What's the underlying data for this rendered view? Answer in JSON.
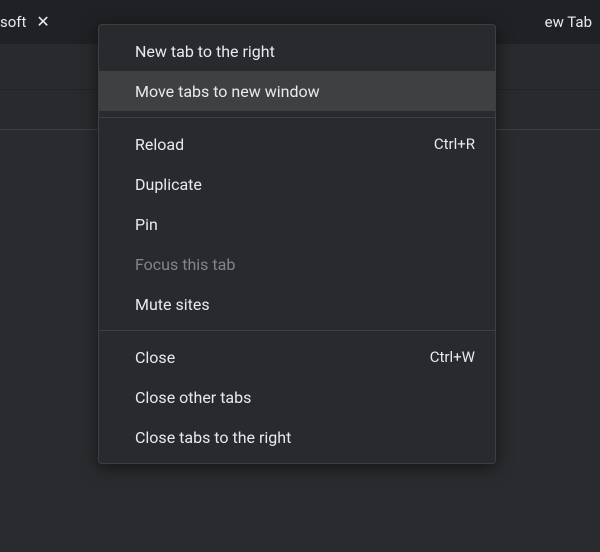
{
  "tabs": {
    "left_fragment": "soft",
    "right_fragment": "ew Tab"
  },
  "context_menu": {
    "groups": [
      {
        "items": [
          {
            "label": "New tab to the right",
            "shortcut": "",
            "disabled": false,
            "hovered": false,
            "name": "menu-new-tab-right"
          },
          {
            "label": "Move tabs to new window",
            "shortcut": "",
            "disabled": false,
            "hovered": true,
            "name": "menu-move-tabs-new-window"
          }
        ]
      },
      {
        "items": [
          {
            "label": "Reload",
            "shortcut": "Ctrl+R",
            "disabled": false,
            "hovered": false,
            "name": "menu-reload"
          },
          {
            "label": "Duplicate",
            "shortcut": "",
            "disabled": false,
            "hovered": false,
            "name": "menu-duplicate"
          },
          {
            "label": "Pin",
            "shortcut": "",
            "disabled": false,
            "hovered": false,
            "name": "menu-pin"
          },
          {
            "label": "Focus this tab",
            "shortcut": "",
            "disabled": true,
            "hovered": false,
            "name": "menu-focus-this-tab"
          },
          {
            "label": "Mute sites",
            "shortcut": "",
            "disabled": false,
            "hovered": false,
            "name": "menu-mute-sites"
          }
        ]
      },
      {
        "items": [
          {
            "label": "Close",
            "shortcut": "Ctrl+W",
            "disabled": false,
            "hovered": false,
            "name": "menu-close"
          },
          {
            "label": "Close other tabs",
            "shortcut": "",
            "disabled": false,
            "hovered": false,
            "name": "menu-close-other-tabs"
          },
          {
            "label": "Close tabs to the right",
            "shortcut": "",
            "disabled": false,
            "hovered": false,
            "name": "menu-close-tabs-right"
          }
        ]
      }
    ]
  }
}
